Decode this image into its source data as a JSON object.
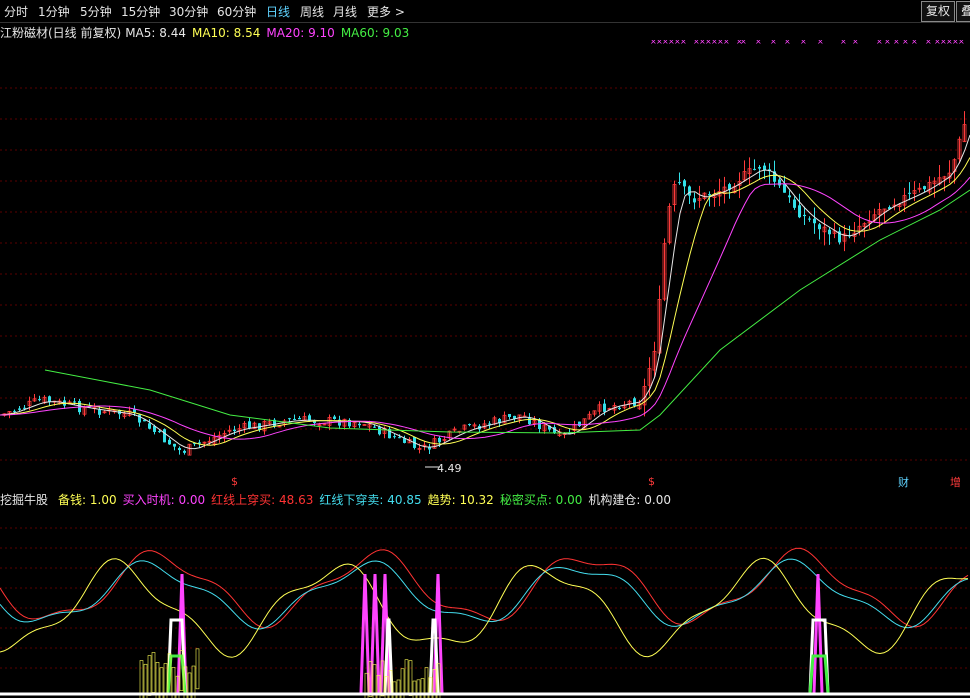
{
  "toolbar": {
    "periods": [
      "分时",
      "1分钟",
      "5分钟",
      "15分钟",
      "30分钟",
      "60分钟",
      "日线",
      "周线",
      "月线",
      "更多 >"
    ],
    "active_index": 6,
    "restore_button": "复权",
    "overlay_button": "叠"
  },
  "main_legend": {
    "title": "江粉磁材(日线 前复权)",
    "ma5": "MA5: 8.44",
    "ma10": "MA10: 8.54",
    "ma20": "MA20: 9.10",
    "ma60": "MA60: 9.03",
    "colors": {
      "title": "#e6e6e6",
      "ma5": "#e6e6e6",
      "ma10": "#ffff55",
      "ma20": "#ff44ff",
      "ma60": "#44ee44"
    }
  },
  "price_annotation": "4.49",
  "event_marks": {
    "s1": "$",
    "s2": "$",
    "cai": "财",
    "zeng": "增"
  },
  "indicator_legend": {
    "name": "挖掘牛股",
    "items": [
      {
        "label": "备钱: 1.00",
        "color": "#ffff55"
      },
      {
        "label": "买入时机: 0.00",
        "color": "#ff44ff"
      },
      {
        "label": "红线上穿买: 48.63",
        "color": "#ff3333"
      },
      {
        "label": "红线下穿卖: 40.85",
        "color": "#44ddee"
      },
      {
        "label": "趋势: 10.32",
        "color": "#ffff55"
      },
      {
        "label": "秘密买点: 0.00",
        "color": "#44ee44"
      },
      {
        "label": "机构建仓: 0.00",
        "color": "#e6e6e6"
      }
    ]
  },
  "theme": {
    "up": "#ff3b3b",
    "down": "#33e0e8",
    "grid": "#5a0000",
    "bg": "#000000"
  }
}
